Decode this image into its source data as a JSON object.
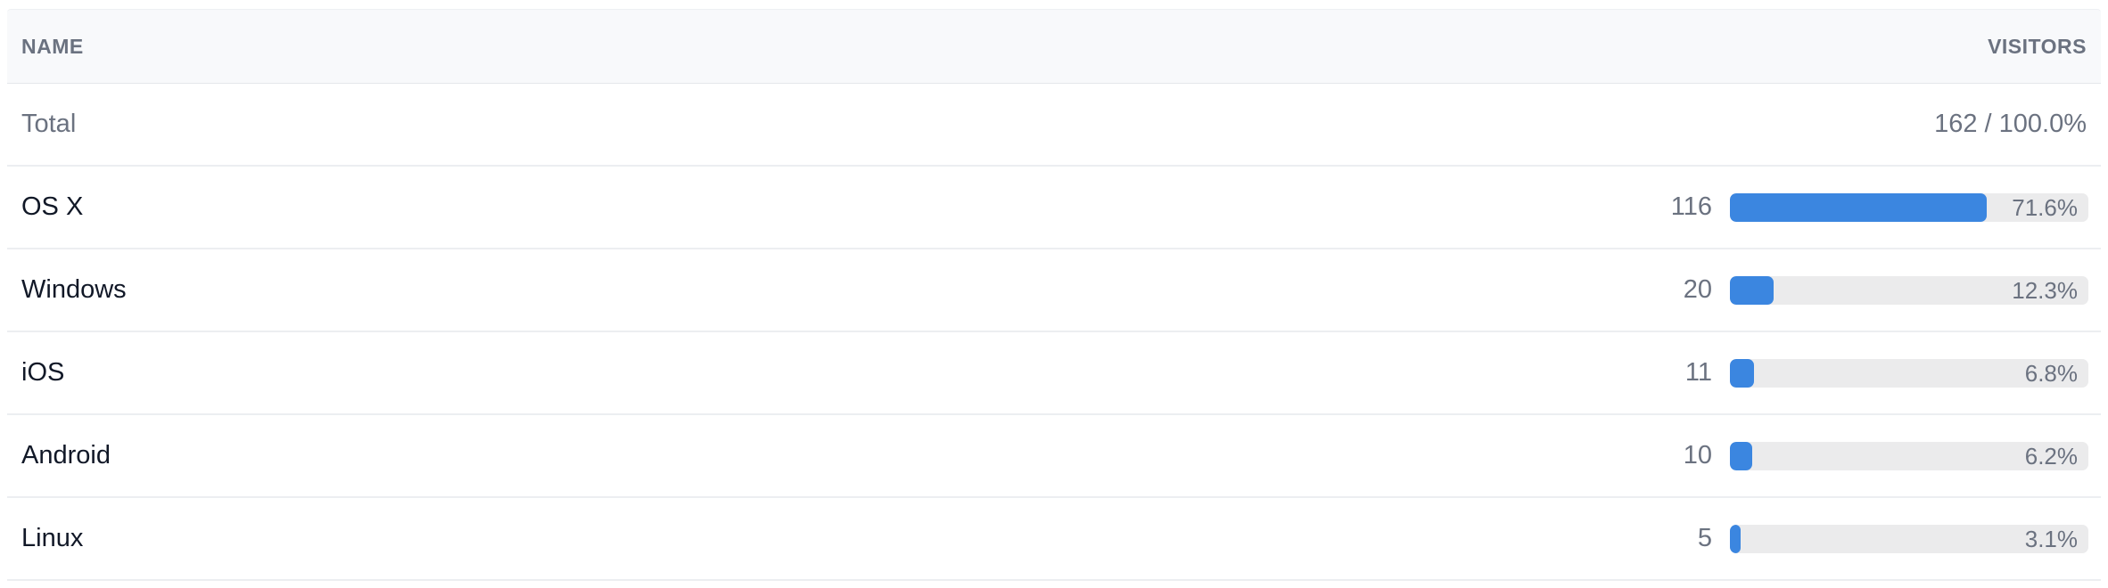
{
  "header": {
    "name_label": "NAME",
    "visitors_label": "VISITORS"
  },
  "total": {
    "label": "Total",
    "value": "162 / 100.0%"
  },
  "rows": [
    {
      "name": "OS X",
      "count": "116",
      "percent_label": "71.6%",
      "percent": 71.6
    },
    {
      "name": "Windows",
      "count": "20",
      "percent_label": "12.3%",
      "percent": 12.3
    },
    {
      "name": "iOS",
      "count": "11",
      "percent_label": "6.8%",
      "percent": 6.8
    },
    {
      "name": "Android",
      "count": "10",
      "percent_label": "6.2%",
      "percent": 6.2
    },
    {
      "name": "Linux",
      "count": "5",
      "percent_label": "3.1%",
      "percent": 3.1
    }
  ],
  "colors": {
    "bar_fill": "#3b86e0",
    "bar_track": "#ebebec"
  }
}
